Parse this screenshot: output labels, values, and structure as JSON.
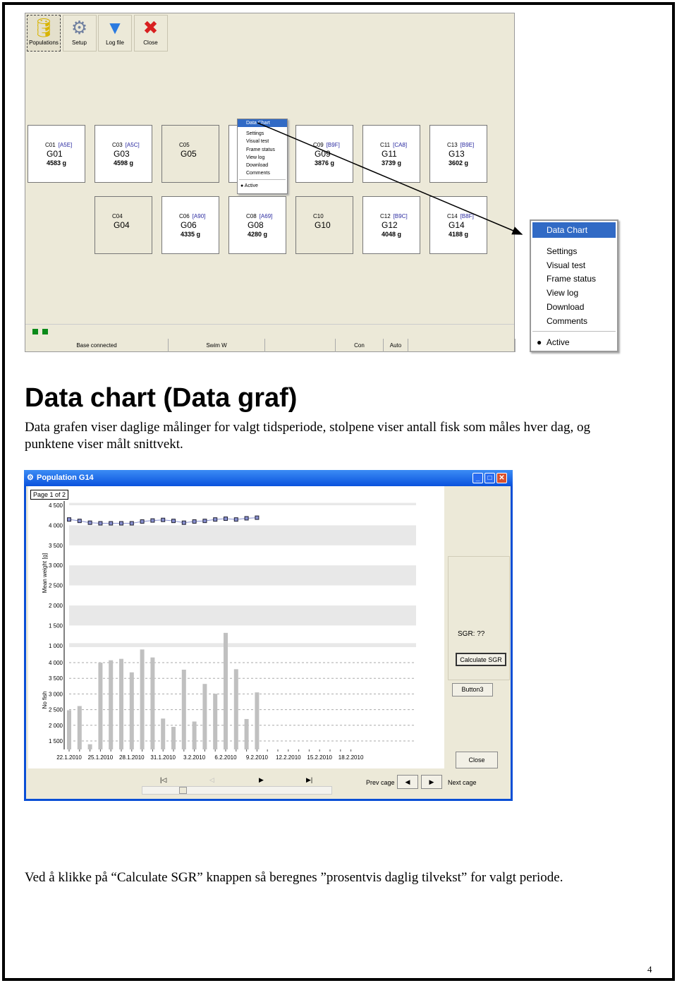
{
  "app": {
    "toolbar": [
      {
        "label": "Populations",
        "icon": "database-arrow-icon"
      },
      {
        "label": "Setup",
        "icon": "gear-wrench-icon"
      },
      {
        "label": "Log file",
        "icon": "funnel-icon"
      },
      {
        "label": "Close",
        "icon": "close-circle-icon"
      }
    ],
    "tiles": [
      {
        "cage": "C01",
        "tag": "[A5E]",
        "name": "G01",
        "weight": "4583 g",
        "active": true
      },
      {
        "cage": "C03",
        "tag": "[A5C]",
        "name": "G03",
        "weight": "4598 g",
        "active": true
      },
      {
        "cage": "C05",
        "tag": "",
        "name": "G05",
        "weight": "",
        "active": false
      },
      {
        "cage": "",
        "tag": "",
        "name": "",
        "weight": "",
        "active": true
      },
      {
        "cage": "C09",
        "tag": "[B9F]",
        "name": "G09",
        "weight": "3876 g",
        "active": true
      },
      {
        "cage": "C11",
        "tag": "[CA8]",
        "name": "G11",
        "weight": "3739 g",
        "active": true
      },
      {
        "cage": "C13",
        "tag": "[B9E]",
        "name": "G13",
        "weight": "3602 g",
        "active": true
      },
      {
        "cage": "C04",
        "tag": "",
        "name": "G04",
        "weight": "",
        "active": false
      },
      {
        "cage": "C06",
        "tag": "[A90]",
        "name": "G06",
        "weight": "4335 g",
        "active": true
      },
      {
        "cage": "C08",
        "tag": "[A69]",
        "name": "G08",
        "weight": "4280 g",
        "active": true
      },
      {
        "cage": "C10",
        "tag": "",
        "name": "G10",
        "weight": "",
        "active": false
      },
      {
        "cage": "C12",
        "tag": "[B9C]",
        "name": "G12",
        "weight": "4048 g",
        "active": true
      },
      {
        "cage": "C14",
        "tag": "[B8F]",
        "name": "G14",
        "weight": "4188 g",
        "active": true
      }
    ],
    "context_menu": {
      "header": "Data Chart",
      "items": [
        "Settings",
        "Visual test",
        "Frame status",
        "View log",
        "Download",
        "Comments"
      ],
      "active": "Active"
    },
    "status": [
      "Base connected",
      "Swim W",
      "",
      "Con",
      "Auto"
    ],
    "indicator_color": "#0a8a1a"
  },
  "heading": "Data chart (Data graf)",
  "intro_line1": "Data grafen viser daglige målinger for valgt tidsperiode, stolpene viser antall fisk som måles hver dag, og",
  "intro_line2": "punktene viser målt snittvekt.",
  "chart_window": {
    "title": "Population G14",
    "page_label": "Page 1 of 2",
    "sgr_label": "SGR:  ??",
    "calculate_button": "Calculate SGR",
    "button3": "Button3",
    "close_button": "Close",
    "prev_cage": "Prev cage",
    "next_cage": "Next cage"
  },
  "chart_data": [
    {
      "type": "line",
      "ylabel": "Mean weight [g]",
      "yticks": [
        "4 500",
        "4 000",
        "3 500",
        "3 000",
        "2 500",
        "2 000",
        "1 500",
        "1 000"
      ],
      "ylim": [
        1000,
        4500
      ],
      "x": [
        "22.1.2010",
        "23.1.2010",
        "24.1.2010",
        "25.1.2010",
        "26.1.2010",
        "27.1.2010",
        "28.1.2010",
        "29.1.2010",
        "30.1.2010",
        "31.1.2010",
        "1.2.2010",
        "2.2.2010",
        "3.2.2010",
        "4.2.2010",
        "5.2.2010",
        "6.2.2010",
        "7.2.2010",
        "8.2.2010",
        "9.2.2010"
      ],
      "values": [
        4145,
        4110,
        4065,
        4050,
        4050,
        4050,
        4050,
        4095,
        4120,
        4135,
        4110,
        4065,
        4095,
        4110,
        4145,
        4165,
        4145,
        4175,
        4190
      ],
      "color": "#8890d0"
    },
    {
      "type": "bar",
      "ylabel": "No fish",
      "yticks": [
        "4 000",
        "3 500",
        "3 000",
        "2 500",
        "2 000",
        "1 500"
      ],
      "xticks": [
        "22.1.2010",
        "25.1.2010",
        "28.1.2010",
        "31.1.2010",
        "3.2.2010",
        "6.2.2010",
        "9.2.2010",
        "12.2.2010",
        "15.2.2010",
        "18.2.2010"
      ],
      "values": [
        2480,
        2615,
        1395,
        4000,
        4075,
        4120,
        3690,
        4420,
        4165,
        2215,
        1950,
        3775,
        2120,
        3320,
        3005,
        4950,
        3790,
        2200,
        3050
      ],
      "color": "#c0c0c0",
      "grid": true
    }
  ],
  "outro": "Ved å klikke på “Calculate SGR” knappen så beregnes ”prosentvis daglig tilvekst” for valgt periode.",
  "page_number": "4"
}
